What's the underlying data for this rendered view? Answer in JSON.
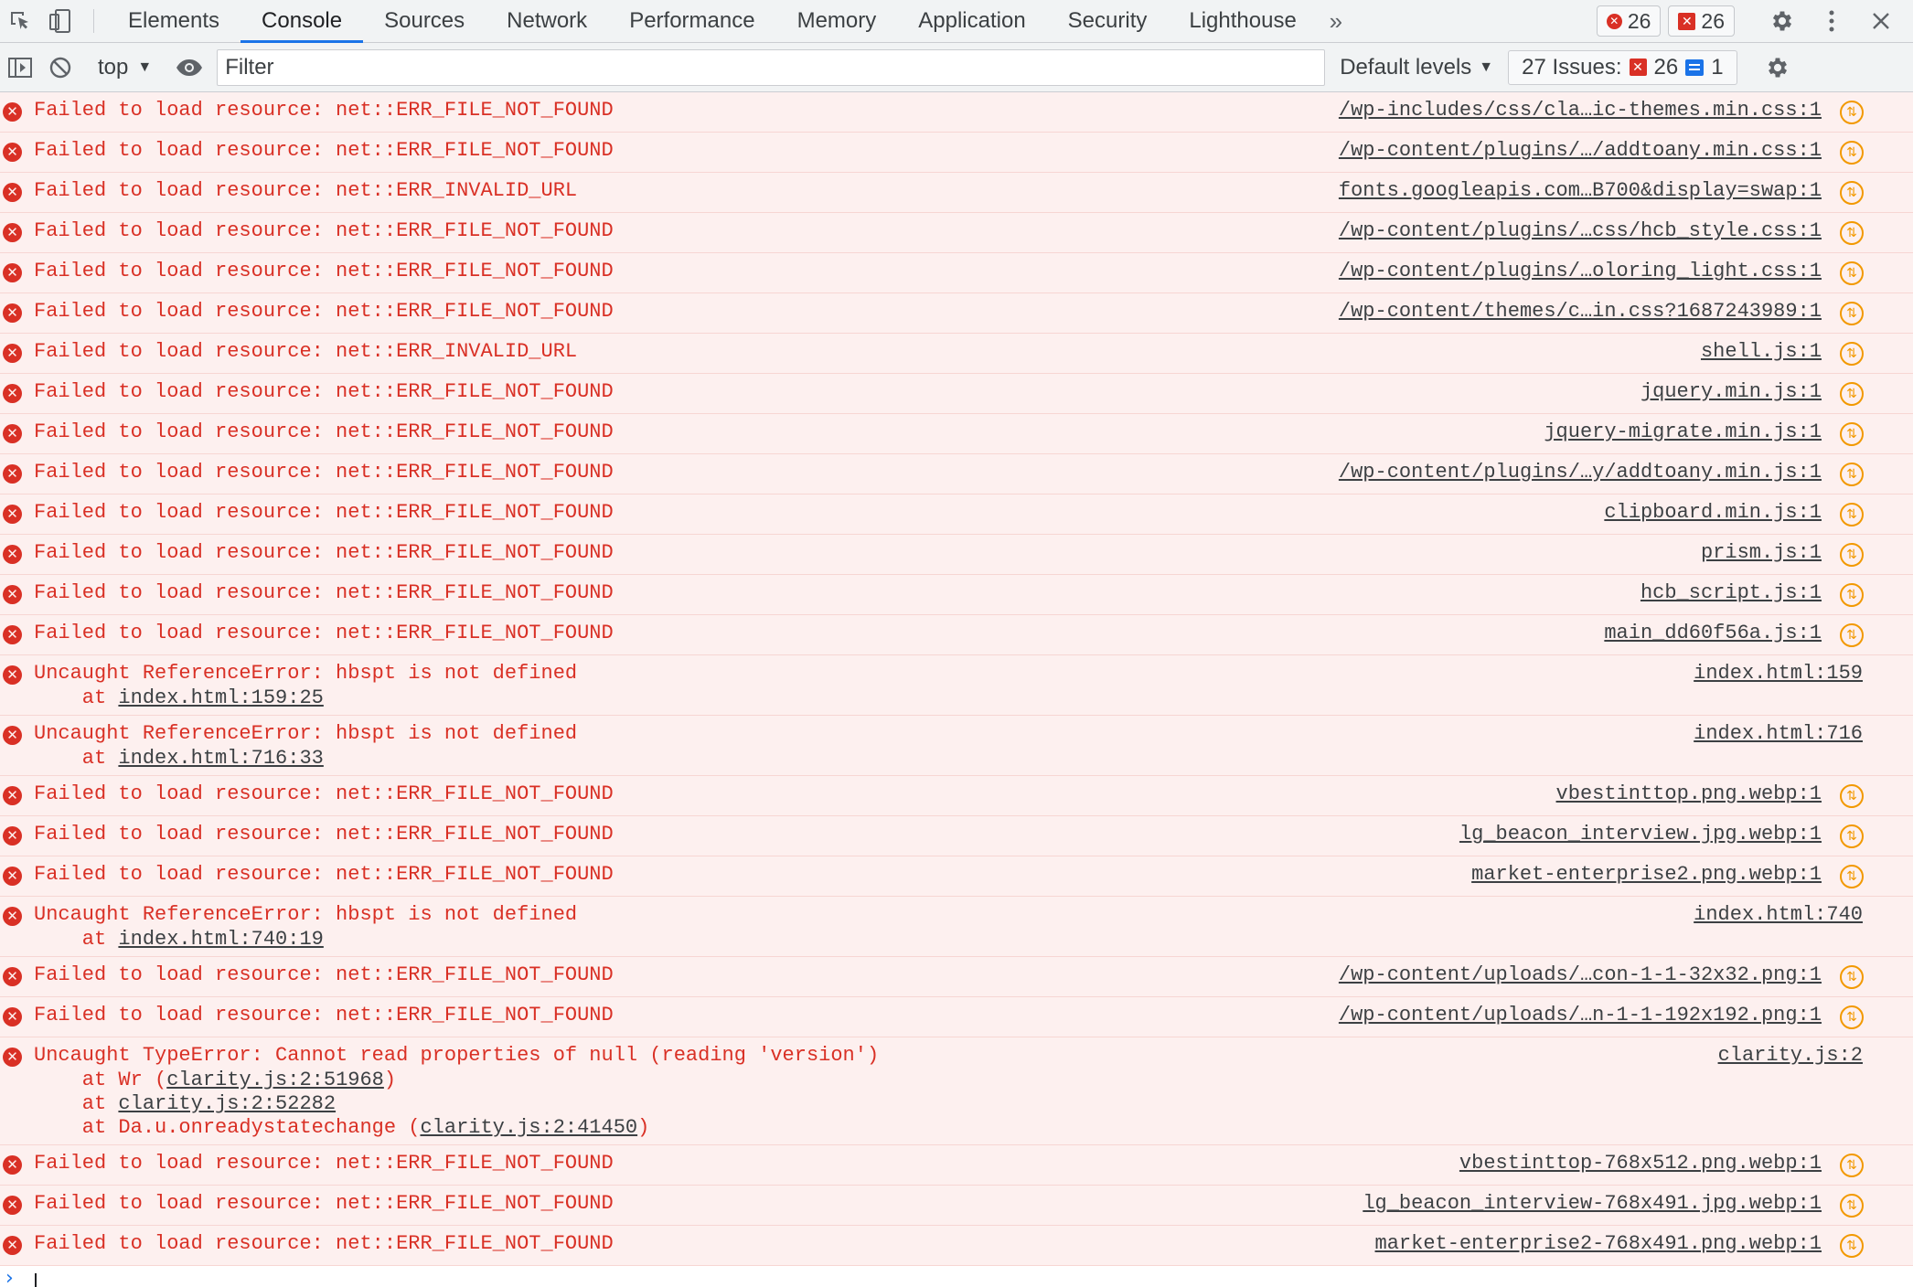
{
  "tabs": [
    {
      "label": "Elements",
      "active": false
    },
    {
      "label": "Console",
      "active": true
    },
    {
      "label": "Sources",
      "active": false
    },
    {
      "label": "Network",
      "active": false
    },
    {
      "label": "Performance",
      "active": false
    },
    {
      "label": "Memory",
      "active": false
    },
    {
      "label": "Application",
      "active": false
    },
    {
      "label": "Security",
      "active": false
    },
    {
      "label": "Lighthouse",
      "active": false
    }
  ],
  "header": {
    "more_tabs_glyph": "»",
    "error_count": "26",
    "issue_error_count": "26"
  },
  "toolbar": {
    "context": "top",
    "filter_placeholder": "Filter",
    "filter_value": "",
    "levels_label": "Default levels",
    "issues_label": "27 Issues:",
    "issues_errors": "26",
    "issues_info": "1"
  },
  "icons": {
    "error": "x-circle-icon",
    "network_fx": "network-request-icon",
    "settings": "gear-icon",
    "menu": "kebab-icon",
    "close": "close-icon"
  },
  "colors": {
    "error_text": "#d93025",
    "error_bg": "#fdf0ef",
    "accent": "#1a73e8",
    "network_icon": "#f29900"
  },
  "messages": [
    {
      "text": "Failed to load resource: net::ERR_FILE_NOT_FOUND",
      "source": "/wp-includes/css/cla…ic-themes.min.css:1",
      "network": true,
      "stack": []
    },
    {
      "text": "Failed to load resource: net::ERR_FILE_NOT_FOUND",
      "source": "/wp-content/plugins/…/addtoany.min.css:1",
      "network": true,
      "stack": []
    },
    {
      "text": "Failed to load resource: net::ERR_INVALID_URL",
      "source": "fonts.googleapis.com…B700&display=swap:1",
      "network": true,
      "stack": []
    },
    {
      "text": "Failed to load resource: net::ERR_FILE_NOT_FOUND",
      "source": "/wp-content/plugins/…css/hcb_style.css:1",
      "network": true,
      "stack": []
    },
    {
      "text": "Failed to load resource: net::ERR_FILE_NOT_FOUND",
      "source": "/wp-content/plugins/…oloring_light.css:1",
      "network": true,
      "stack": []
    },
    {
      "text": "Failed to load resource: net::ERR_FILE_NOT_FOUND",
      "source": "/wp-content/themes/c…in.css?1687243989:1",
      "network": true,
      "stack": []
    },
    {
      "text": "Failed to load resource: net::ERR_INVALID_URL",
      "source": "shell.js:1",
      "network": true,
      "stack": []
    },
    {
      "text": "Failed to load resource: net::ERR_FILE_NOT_FOUND",
      "source": "jquery.min.js:1",
      "network": true,
      "stack": []
    },
    {
      "text": "Failed to load resource: net::ERR_FILE_NOT_FOUND",
      "source": "jquery-migrate.min.js:1",
      "network": true,
      "stack": []
    },
    {
      "text": "Failed to load resource: net::ERR_FILE_NOT_FOUND",
      "source": "/wp-content/plugins/…y/addtoany.min.js:1",
      "network": true,
      "stack": []
    },
    {
      "text": "Failed to load resource: net::ERR_FILE_NOT_FOUND",
      "source": "clipboard.min.js:1",
      "network": true,
      "stack": []
    },
    {
      "text": "Failed to load resource: net::ERR_FILE_NOT_FOUND",
      "source": "prism.js:1",
      "network": true,
      "stack": []
    },
    {
      "text": "Failed to load resource: net::ERR_FILE_NOT_FOUND",
      "source": "hcb_script.js:1",
      "network": true,
      "stack": []
    },
    {
      "text": "Failed to load resource: net::ERR_FILE_NOT_FOUND",
      "source": "main_dd60f56a.js:1",
      "network": true,
      "stack": []
    },
    {
      "text": "Uncaught ReferenceError: hbspt is not defined",
      "source": "index.html:159",
      "network": false,
      "stack": [
        {
          "prefix": "    at ",
          "link": "index.html:159:25",
          "suffix": ""
        }
      ]
    },
    {
      "text": "Uncaught ReferenceError: hbspt is not defined",
      "source": "index.html:716",
      "network": false,
      "stack": [
        {
          "prefix": "    at ",
          "link": "index.html:716:33",
          "suffix": ""
        }
      ]
    },
    {
      "text": "Failed to load resource: net::ERR_FILE_NOT_FOUND",
      "source": "vbestinttop.png.webp:1",
      "network": true,
      "stack": []
    },
    {
      "text": "Failed to load resource: net::ERR_FILE_NOT_FOUND",
      "source": "lg_beacon_interview.jpg.webp:1",
      "network": true,
      "stack": []
    },
    {
      "text": "Failed to load resource: net::ERR_FILE_NOT_FOUND",
      "source": "market-enterprise2.png.webp:1",
      "network": true,
      "stack": []
    },
    {
      "text": "Uncaught ReferenceError: hbspt is not defined",
      "source": "index.html:740",
      "network": false,
      "stack": [
        {
          "prefix": "    at ",
          "link": "index.html:740:19",
          "suffix": ""
        }
      ]
    },
    {
      "text": "Failed to load resource: net::ERR_FILE_NOT_FOUND",
      "source": "/wp-content/uploads/…con-1-1-32x32.png:1",
      "network": true,
      "stack": []
    },
    {
      "text": "Failed to load resource: net::ERR_FILE_NOT_FOUND",
      "source": "/wp-content/uploads/…n-1-1-192x192.png:1",
      "network": true,
      "stack": []
    },
    {
      "text": "Uncaught TypeError: Cannot read properties of null (reading 'version')",
      "source": "clarity.js:2",
      "network": false,
      "stack": [
        {
          "prefix": "    at Wr (",
          "link": "clarity.js:2:51968",
          "suffix": ")"
        },
        {
          "prefix": "    at ",
          "link": "clarity.js:2:52282",
          "suffix": ""
        },
        {
          "prefix": "    at Da.u.onreadystatechange (",
          "link": "clarity.js:2:41450",
          "suffix": ")"
        }
      ]
    },
    {
      "text": "Failed to load resource: net::ERR_FILE_NOT_FOUND",
      "source": "vbestinttop-768x512.png.webp:1",
      "network": true,
      "stack": []
    },
    {
      "text": "Failed to load resource: net::ERR_FILE_NOT_FOUND",
      "source": "lg_beacon_interview-768x491.jpg.webp:1",
      "network": true,
      "stack": []
    },
    {
      "text": "Failed to load resource: net::ERR_FILE_NOT_FOUND",
      "source": "market-enterprise2-768x491.png.webp:1",
      "network": true,
      "stack": []
    }
  ],
  "prompt": {
    "glyph": "›"
  }
}
